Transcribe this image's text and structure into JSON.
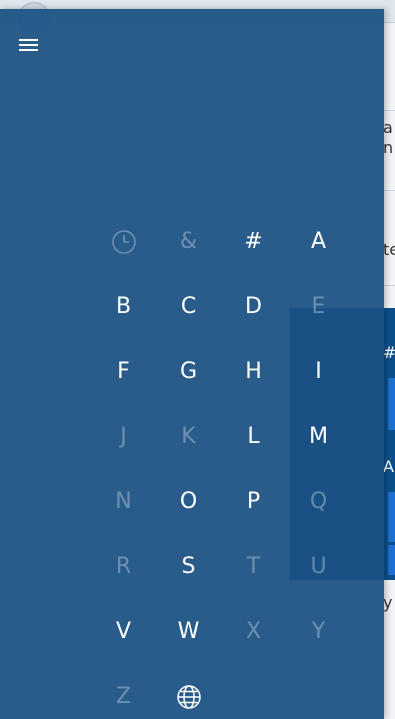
{
  "background": {
    "side_text": [
      {
        "text": "a"
      },
      {
        "text": "n"
      },
      {
        "text": "te"
      },
      {
        "text": "#"
      },
      {
        "text": "A"
      },
      {
        "text": "y"
      }
    ]
  },
  "menu": {
    "hamburger_icon": "hamburger-menu-icon",
    "rows": [
      [
        {
          "name": "recent-icon",
          "label": "",
          "icon": "clock",
          "enabled": false
        },
        {
          "name": "letter-ampersand",
          "label": "&",
          "enabled": false
        },
        {
          "name": "letter-hash",
          "label": "#",
          "enabled": true
        },
        {
          "name": "letter-a",
          "label": "A",
          "enabled": true
        }
      ],
      [
        {
          "name": "letter-b",
          "label": "B",
          "enabled": true
        },
        {
          "name": "letter-c",
          "label": "C",
          "enabled": true
        },
        {
          "name": "letter-d",
          "label": "D",
          "enabled": true
        },
        {
          "name": "letter-e",
          "label": "E",
          "enabled": false
        }
      ],
      [
        {
          "name": "letter-f",
          "label": "F",
          "enabled": true
        },
        {
          "name": "letter-g",
          "label": "G",
          "enabled": true
        },
        {
          "name": "letter-h",
          "label": "H",
          "enabled": true
        },
        {
          "name": "letter-i",
          "label": "I",
          "enabled": true
        }
      ],
      [
        {
          "name": "letter-j",
          "label": "J",
          "enabled": false
        },
        {
          "name": "letter-k",
          "label": "K",
          "enabled": false
        },
        {
          "name": "letter-l",
          "label": "L",
          "enabled": true
        },
        {
          "name": "letter-m",
          "label": "M",
          "enabled": true
        }
      ],
      [
        {
          "name": "letter-n",
          "label": "N",
          "enabled": false
        },
        {
          "name": "letter-o",
          "label": "O",
          "enabled": true
        },
        {
          "name": "letter-p",
          "label": "P",
          "enabled": true
        },
        {
          "name": "letter-q",
          "label": "Q",
          "enabled": false
        }
      ],
      [
        {
          "name": "letter-r",
          "label": "R",
          "enabled": false
        },
        {
          "name": "letter-s",
          "label": "S",
          "enabled": true
        },
        {
          "name": "letter-t",
          "label": "T",
          "enabled": false
        },
        {
          "name": "letter-u",
          "label": "U",
          "enabled": false
        }
      ],
      [
        {
          "name": "letter-v",
          "label": "V",
          "enabled": true
        },
        {
          "name": "letter-w",
          "label": "W",
          "enabled": true
        },
        {
          "name": "letter-x",
          "label": "X",
          "enabled": false
        },
        {
          "name": "letter-y",
          "label": "Y",
          "enabled": false
        }
      ],
      [
        {
          "name": "letter-z",
          "label": "Z",
          "enabled": false
        },
        {
          "name": "globe-icon",
          "label": "",
          "icon": "globe",
          "enabled": true
        }
      ]
    ]
  }
}
